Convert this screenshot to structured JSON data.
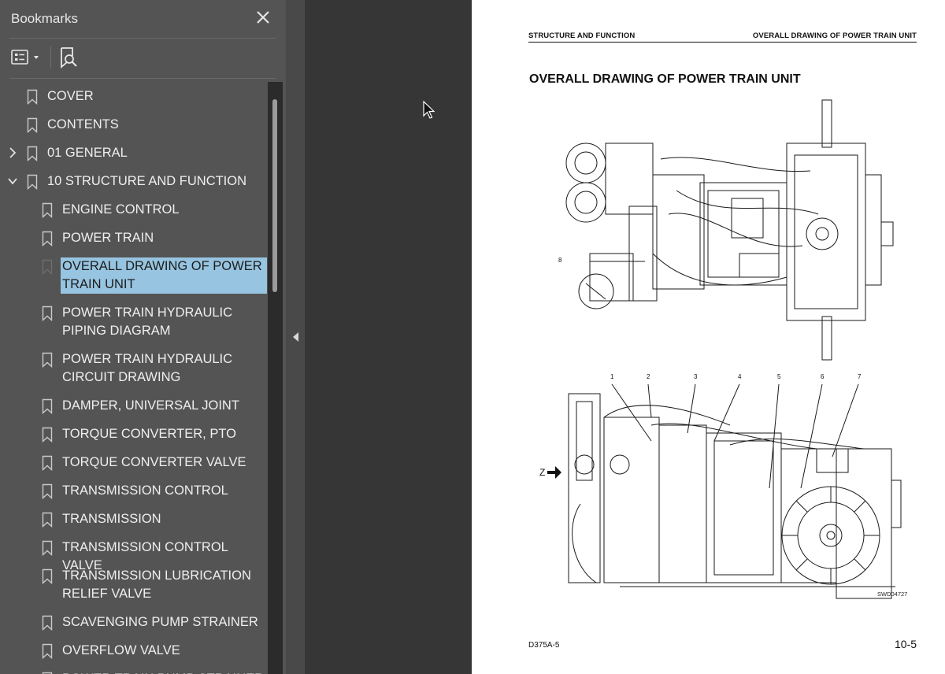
{
  "sidebar": {
    "title": "Bookmarks",
    "bookmarks": [
      {
        "label": "COVER",
        "level": 0,
        "expander": "none",
        "selected": false
      },
      {
        "label": "CONTENTS",
        "level": 0,
        "expander": "none",
        "selected": false
      },
      {
        "label": "01 GENERAL",
        "level": 0,
        "expander": "collapsed",
        "selected": false
      },
      {
        "label": "10 STRUCTURE AND FUNCTION",
        "level": 0,
        "expander": "expanded",
        "selected": false
      },
      {
        "label": "ENGINE CONTROL",
        "level": 1,
        "expander": "none",
        "selected": false
      },
      {
        "label": "POWER TRAIN",
        "level": 1,
        "expander": "none",
        "selected": false
      },
      {
        "label": "OVERALL DRAWING OF POWER TRAIN UNIT",
        "level": 1,
        "expander": "none",
        "selected": true
      },
      {
        "label": "POWER TRAIN HYDRAULIC PIPING DIAGRAM",
        "level": 1,
        "expander": "none",
        "selected": false
      },
      {
        "label": "POWER TRAIN HYDRAULIC CIRCUIT DRAWING",
        "level": 1,
        "expander": "none",
        "selected": false
      },
      {
        "label": "DAMPER, UNIVERSAL JOINT",
        "level": 1,
        "expander": "none",
        "selected": false
      },
      {
        "label": "TORQUE CONVERTER, PTO",
        "level": 1,
        "expander": "none",
        "selected": false
      },
      {
        "label": "TORQUE CONVERTER VALVE",
        "level": 1,
        "expander": "none",
        "selected": false
      },
      {
        "label": "TRANSMISSION CONTROL",
        "level": 1,
        "expander": "none",
        "selected": false
      },
      {
        "label": "TRANSMISSION",
        "level": 1,
        "expander": "none",
        "selected": false
      },
      {
        "label": "TRANSMISSION CONTROL VALVE",
        "level": 1,
        "expander": "none",
        "selected": false
      },
      {
        "label": "TRANSMISSION LUBRICATION RELIEF VALVE",
        "level": 1,
        "expander": "none",
        "selected": false
      },
      {
        "label": "SCAVENGING PUMP STRAINER",
        "level": 1,
        "expander": "none",
        "selected": false
      },
      {
        "label": "OVERFLOW VALVE",
        "level": 1,
        "expander": "none",
        "selected": false
      },
      {
        "label": "POWER TRAIN PUMP STRAINER",
        "level": 1,
        "expander": "none",
        "selected": false
      }
    ]
  },
  "page": {
    "header_left": "STRUCTURE AND FUNCTION",
    "header_right": "OVERALL DRAWING OF POWER TRAIN UNIT",
    "heading": "OVERALL DRAWING OF POWER TRAIN UNIT",
    "callout_top": "8",
    "callouts_bottom": [
      "1",
      "2",
      "3",
      "4",
      "5",
      "6",
      "7"
    ],
    "view_label": "Z",
    "figure_code": "SWD04727",
    "doc_model": "D375A-5",
    "page_number": "10-5"
  },
  "colors": {
    "sidebar_bg": "#545454",
    "selected_bg": "#97c4e0",
    "canvas_bg": "#363636",
    "page_bg": "#ffffff"
  }
}
